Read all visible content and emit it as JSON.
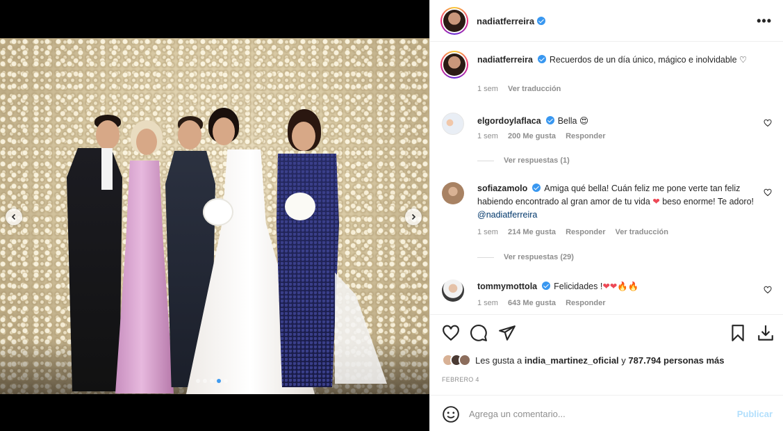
{
  "post": {
    "author": "nadiatferreira",
    "verified": true,
    "caption": "Recuerdos de un día único, mágico e inolvidable ♡",
    "caption_time": "1 sem",
    "caption_translate": "Ver traducción",
    "carousel_dots": 5,
    "carousel_active": 4
  },
  "comments": [
    {
      "user": "elgordoylaflaca",
      "text": "Bella 😍",
      "time": "1 sem",
      "likes": "200 Me gusta",
      "reply": "Responder",
      "view_replies": "Ver respuestas (1)"
    },
    {
      "user": "sofiazamolo",
      "text_before": "Amiga qué bella! Cuán feliz me pone verte tan feliz habiendo encontrado al gran amor de tu vida ",
      "text_heart": "❤",
      "text_after": " beso enorme! Te adoro! ",
      "mention": "@nadiatferreira",
      "time": "1 sem",
      "likes": "214 Me gusta",
      "reply": "Responder",
      "translate": "Ver traducción",
      "view_replies": "Ver respuestas (29)"
    },
    {
      "user": "tommymottola",
      "text_before": "Felicidades !",
      "text_hearts": "❤❤",
      "text_fire": "🔥🔥",
      "time": "1 sem",
      "likes": "643 Me gusta",
      "reply": "Responder"
    }
  ],
  "likes_bar": {
    "prefix": "Les gusta a",
    "first_user": "india_martinez_oficial",
    "connector": "y",
    "others": "787.794 personas más"
  },
  "date": "FEBRERO 4",
  "add_comment": {
    "placeholder": "Agrega un comentario...",
    "publish": "Publicar"
  },
  "icons": {
    "header_more": "more-options-icon",
    "like": "heart-icon",
    "comment": "comment-icon",
    "share": "send-icon",
    "save": "bookmark-icon",
    "download": "download-icon",
    "emoji": "emoji-icon",
    "prev": "chevron-left-icon",
    "next": "chevron-right-icon"
  },
  "colors": {
    "verified_blue": "#3897f0",
    "link_blue": "#00376b",
    "publish_disabled": "#b2dffc",
    "muted_text": "#8e8e8e"
  }
}
